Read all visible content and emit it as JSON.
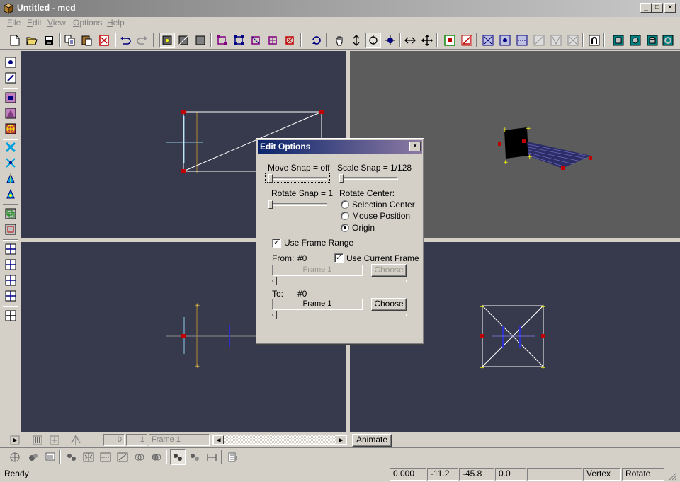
{
  "window": {
    "title": "Untitled - med",
    "minimize": "_",
    "maximize": "□",
    "close": "×"
  },
  "menu": [
    "File",
    "Edit",
    "View",
    "Options",
    "Help"
  ],
  "dialog": {
    "title": "Edit Options",
    "close": "×",
    "move_snap_label": "Move Snap = off",
    "scale_snap_label": "Scale Snap = 1/128",
    "rotate_snap_label": "Rotate Snap = 1",
    "rotate_center_label": "Rotate Center:",
    "rotate_center_options": [
      "Selection Center",
      "Mouse Position",
      "Origin"
    ],
    "rotate_center_selected": "Origin",
    "use_frame_range_label": "Use Frame Range",
    "use_frame_range_checked": true,
    "from_label": "From:",
    "from_value": "#0",
    "use_current_frame_label": "Use Current Frame",
    "use_current_frame_checked": true,
    "from_frame": "Frame 1",
    "choose_label": "Choose",
    "to_label": "To:",
    "to_value": "#0",
    "to_frame": "Frame 1",
    "sliders": {
      "move_snap": 0,
      "scale_snap": 0,
      "rotate_snap": 0,
      "from_frame": 0,
      "to_frame": 0
    }
  },
  "timebar": {
    "frame_start": "0",
    "frame_end": "1",
    "frame_name": "Frame 1",
    "animate_label": "Animate"
  },
  "status": {
    "ready": "Ready",
    "x": "0.000",
    "y": "-11.2",
    "z": "-45.8",
    "w": "0.0",
    "blank": "",
    "mode": "Vertex",
    "tool": "Rotate"
  },
  "colors": {
    "viewport_bg": "#373a4d",
    "perspective_bg": "#5c5c5c",
    "vertex": "#c00000",
    "selected_vertex": "#ffff00",
    "wire": "#ffffff",
    "titlebar_start": "#0a246a",
    "titlebar_end": "#8d7aa3"
  }
}
